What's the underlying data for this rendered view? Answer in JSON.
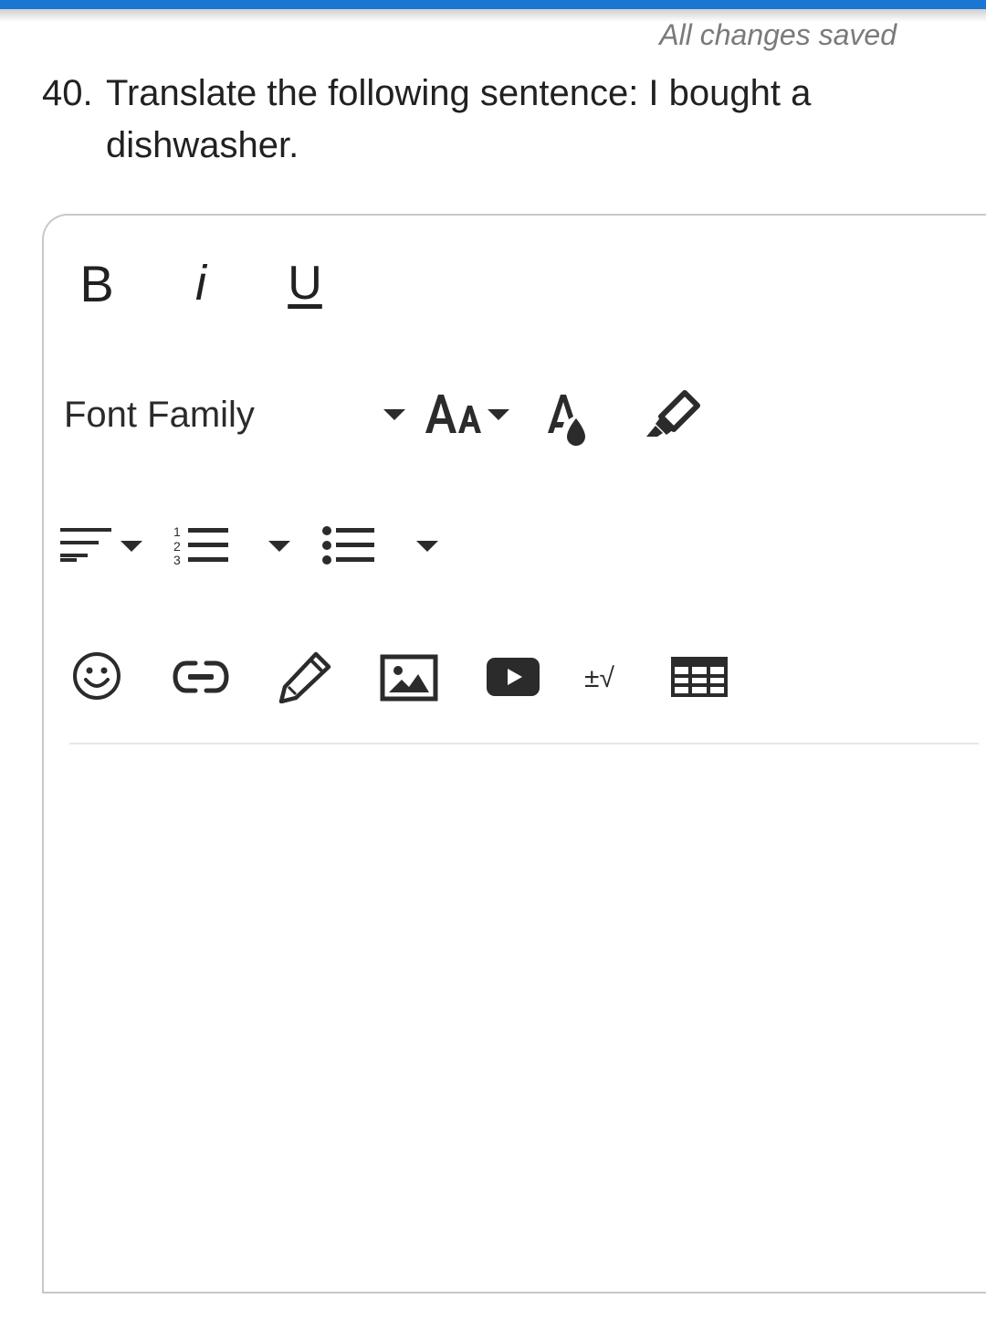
{
  "header": {
    "status_text": "All changes saved",
    "accent_color": "#1976d2"
  },
  "question": {
    "number": "40.",
    "text": "Translate the following sentence: I bought a dishwasher."
  },
  "toolbar": {
    "bold_label": "B",
    "italic_label": "i",
    "underline_label": "U",
    "font_family": {
      "selected": "Font Family"
    },
    "icons": [
      "font-size-icon",
      "text-color-icon",
      "highlight-icon",
      "align-icon",
      "numbered-list-icon",
      "bulleted-list-icon",
      "emoji-icon",
      "link-icon",
      "draw-icon",
      "image-icon",
      "video-icon",
      "math-icon",
      "table-icon"
    ]
  }
}
